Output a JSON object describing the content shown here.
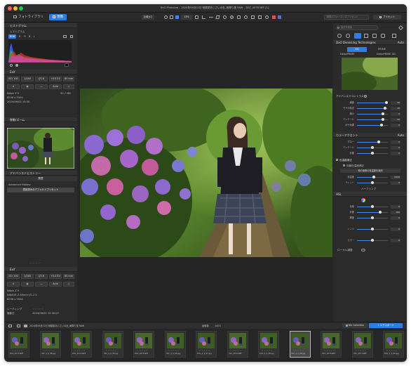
{
  "window": {
    "title": "DxO PhotoLab – 2024年06月02日 相模原あじさいの杜_雨降り風 RAW – DSC_4576.NEF [1]",
    "tabs": [
      "フォトライブラリ",
      "現像"
    ],
    "active_tab": 1
  },
  "toolbar": {
    "compare_label": "比較(C)",
    "zoom_value": "13",
    "zoom_unit": "%",
    "preset_search_placeholder": "新規パフォーマンスプリセット",
    "preset_button": "プリセット"
  },
  "left_panel": {
    "histogram": {
      "title": "ヒストグラム",
      "sub": "ヒストグラム",
      "channels": [
        "RGB",
        "R",
        "G",
        "B",
        "L"
      ]
    },
    "exif": {
      "title": "Exif",
      "values": [
        "ISO 100",
        "1/160",
        "ƒ/2.8",
        "+0.0 EV",
        "85 mm"
      ],
      "camera": "Nikon Z 9",
      "size_mb": "50.7 MB",
      "lens": "8256 x 5504",
      "date": "2024/06/02 15:30"
    },
    "navigator": {
      "title": "移動/ズーム"
    },
    "history": {
      "title": "アドバンスドヒストリー",
      "tab": "履歴",
      "items": [
        "Advanced History",
        "適用済みのデフォルトプリセット"
      ]
    },
    "exif2": {
      "title": "Exif",
      "camera": "Nikon Z 9",
      "lens": "NIKKOR Z 85mm f/1.2 S",
      "size": "8256 x 5504",
      "rating_label": "レーティング",
      "rating_label2": "撮影日",
      "date_value": "2024/06/02 15:30:07"
    }
  },
  "right_panel": {
    "search_placeholder": "設定を検索",
    "denoise": {
      "title": "DxO Denoising Technologies",
      "mode_label": "Auto",
      "buttons": [
        "PRIME",
        "HQ",
        "DeepPRIME",
        "DeepPRIME XD"
      ],
      "selected": "DeepPRIME"
    },
    "light": {
      "title": "アドバンスドコントラスト",
      "rows": [
        {
          "label": "細部",
          "value": "40",
          "frac": 0.95
        },
        {
          "label": "モヤの除去",
          "value": "15",
          "frac": 0.9
        },
        {
          "label": "微小",
          "value": "0",
          "frac": 0.85
        },
        {
          "label": "ディテール",
          "value": "20",
          "frac": 0.85
        },
        {
          "label": "ボケ効果",
          "value": "0",
          "frac": 0.8
        }
      ]
    },
    "color": {
      "title": "カラーアクセント",
      "value": "Auto",
      "rows": [
        {
          "label": "グロー",
          "value": "0",
          "frac": 0.7
        },
        {
          "label": "ディテール",
          "value": "0",
          "frac": 0.5
        },
        {
          "label": "彩度",
          "value": "0",
          "frac": 0.5
        }
      ]
    },
    "wb": {
      "title": "色温度補正",
      "option1": "自動色温度補正",
      "option2": "他の画像の色温度を適用",
      "rows": [
        {
          "label": "色温度",
          "value": "5400",
          "frac": 0.55
        },
        {
          "label": "ティント",
          "value": "0",
          "frac": 0.5
        }
      ]
    },
    "hsl": {
      "title": "ハーフリング",
      "section": "HSL",
      "rows": [
        {
          "label": "色相",
          "value": "0",
          "frac": 0.5
        },
        {
          "label": "彩度",
          "value": "100",
          "frac": 0.75
        },
        {
          "label": "輝度",
          "value": "0",
          "frac": 0.5
        },
        {
          "label": "レンジ",
          "value": "0",
          "frac": 0.5
        },
        {
          "label": "カラー",
          "value": "0",
          "frac": 0.5
        }
      ]
    },
    "local": "ローカル調整"
  },
  "filmstrip": {
    "folder": "2024年06月02日 相模原あじさいの杜_雨降り風 RAW",
    "count_label": "画像数：",
    "count": "1/431",
    "collection": "Nik Collection",
    "export": "エクスポート",
    "thumbs": [
      "DSC_4573.NEF",
      "DSC_4_6_98.jpg",
      "DSC_4574.NEF",
      "DSC_4_6_99.jpg",
      "DSC_4575.NEF",
      "DSC_4_6_96.jpg",
      "DSC_4_6_97.jpg",
      "DSC_4576.NEF",
      "DSC_4_6_98.jpg",
      "DSC_4_6_88.jpg",
      "DSC_4576.NEF",
      "DSC_4577.NEF",
      "DSC_4_6_88.jpg"
    ],
    "selected_index": 9
  },
  "colors": {
    "accent": "#2f7de1",
    "bg": "#262626",
    "panel": "#2b2b2b"
  }
}
